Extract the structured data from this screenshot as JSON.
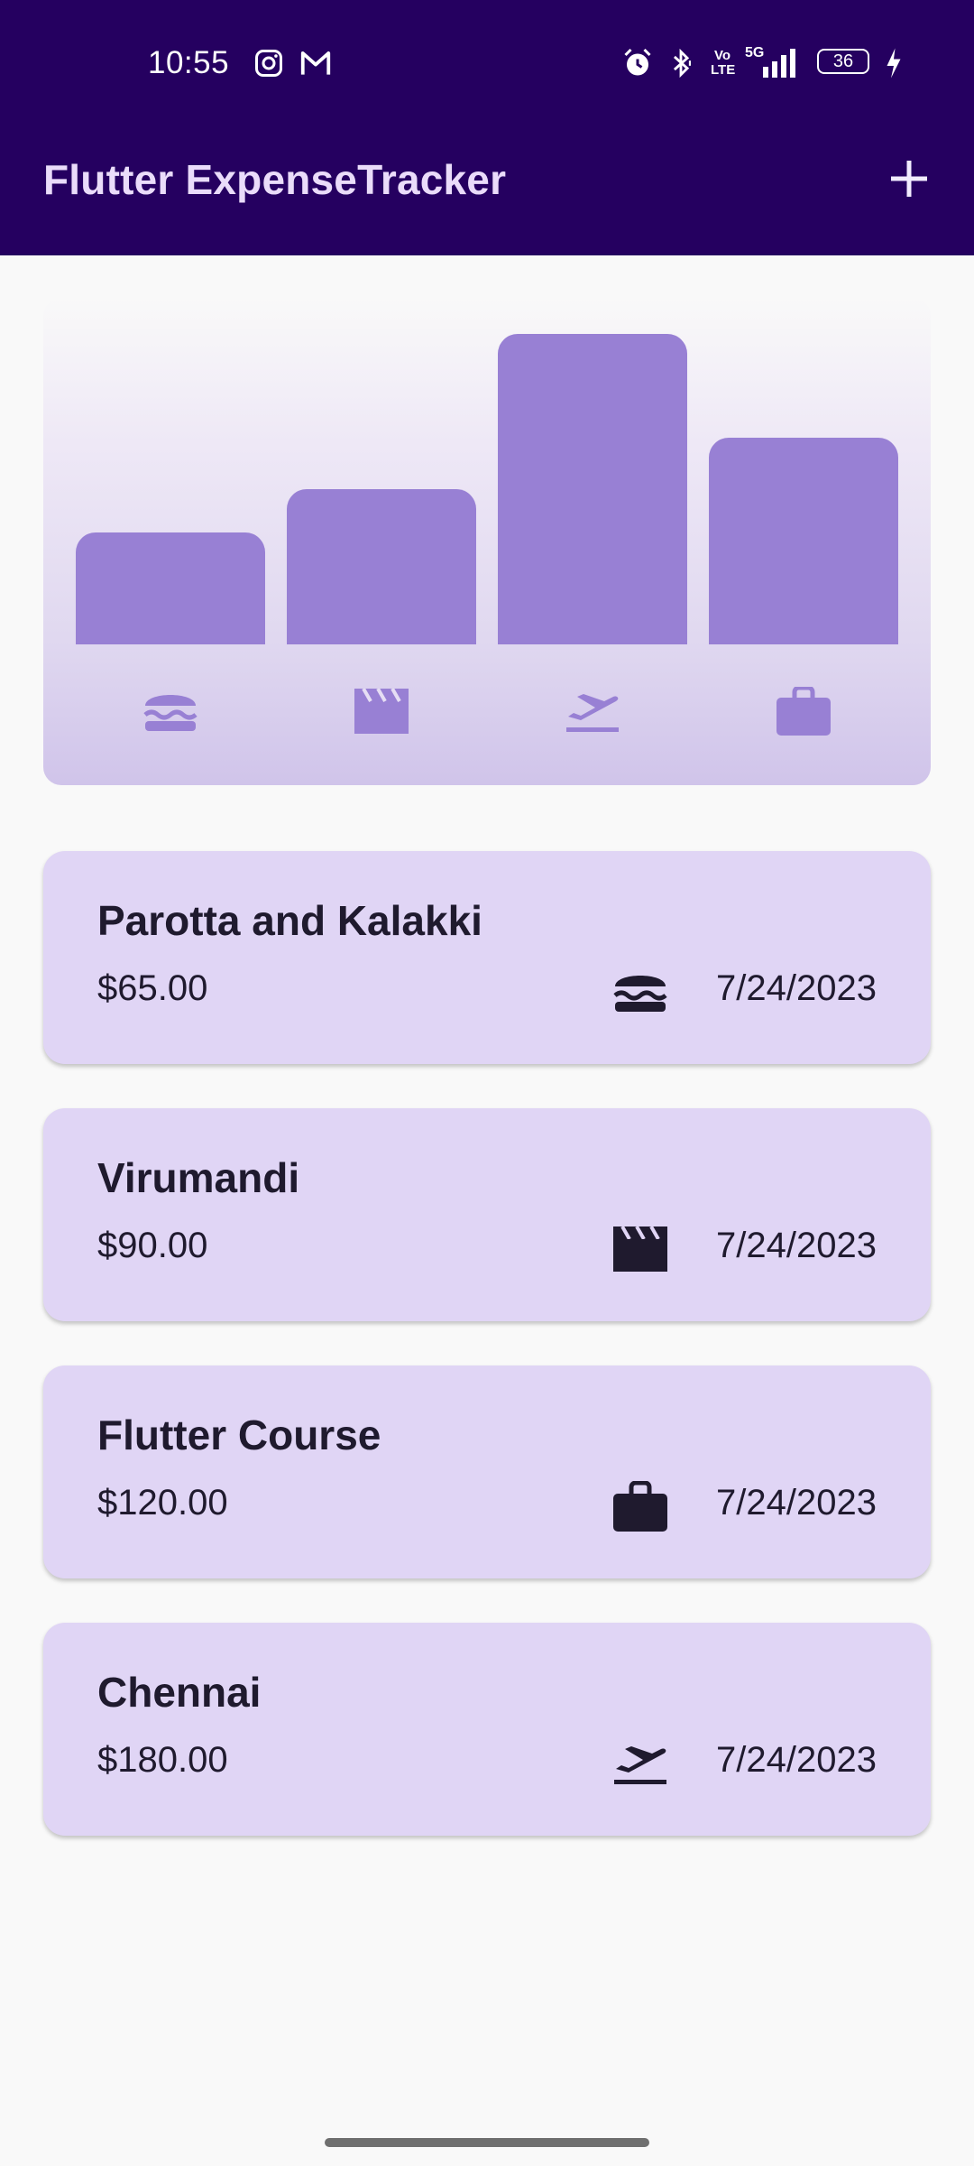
{
  "status_bar": {
    "time": "10:55",
    "network": "5G",
    "lte": "Vo LTE",
    "battery": "36"
  },
  "app_bar": {
    "title": "Flutter ExpenseTracker",
    "add_icon": "plus-icon"
  },
  "chart": {
    "categories": [
      "food",
      "leisure",
      "travel",
      "work"
    ],
    "icons": [
      "burger-icon",
      "movie-clapper-icon",
      "flight-takeoff-icon",
      "briefcase-icon"
    ],
    "values": [
      65,
      90,
      180,
      120
    ],
    "max": 180
  },
  "expenses": [
    {
      "title": "Parotta and Kalakki",
      "amount": "$65.00",
      "icon": "burger-icon",
      "date": "7/24/2023"
    },
    {
      "title": "Virumandi",
      "amount": "$90.00",
      "icon": "movie-clapper-icon",
      "date": "7/24/2023"
    },
    {
      "title": "Flutter Course",
      "amount": "$120.00",
      "icon": "briefcase-icon",
      "date": "7/24/2023"
    },
    {
      "title": "Chennai",
      "amount": "$180.00",
      "icon": "flight-takeoff-icon",
      "date": "7/24/2023"
    }
  ],
  "colors": {
    "app_bar": "#250060",
    "bar": "#9880d4",
    "card": "#e0d5f5"
  }
}
